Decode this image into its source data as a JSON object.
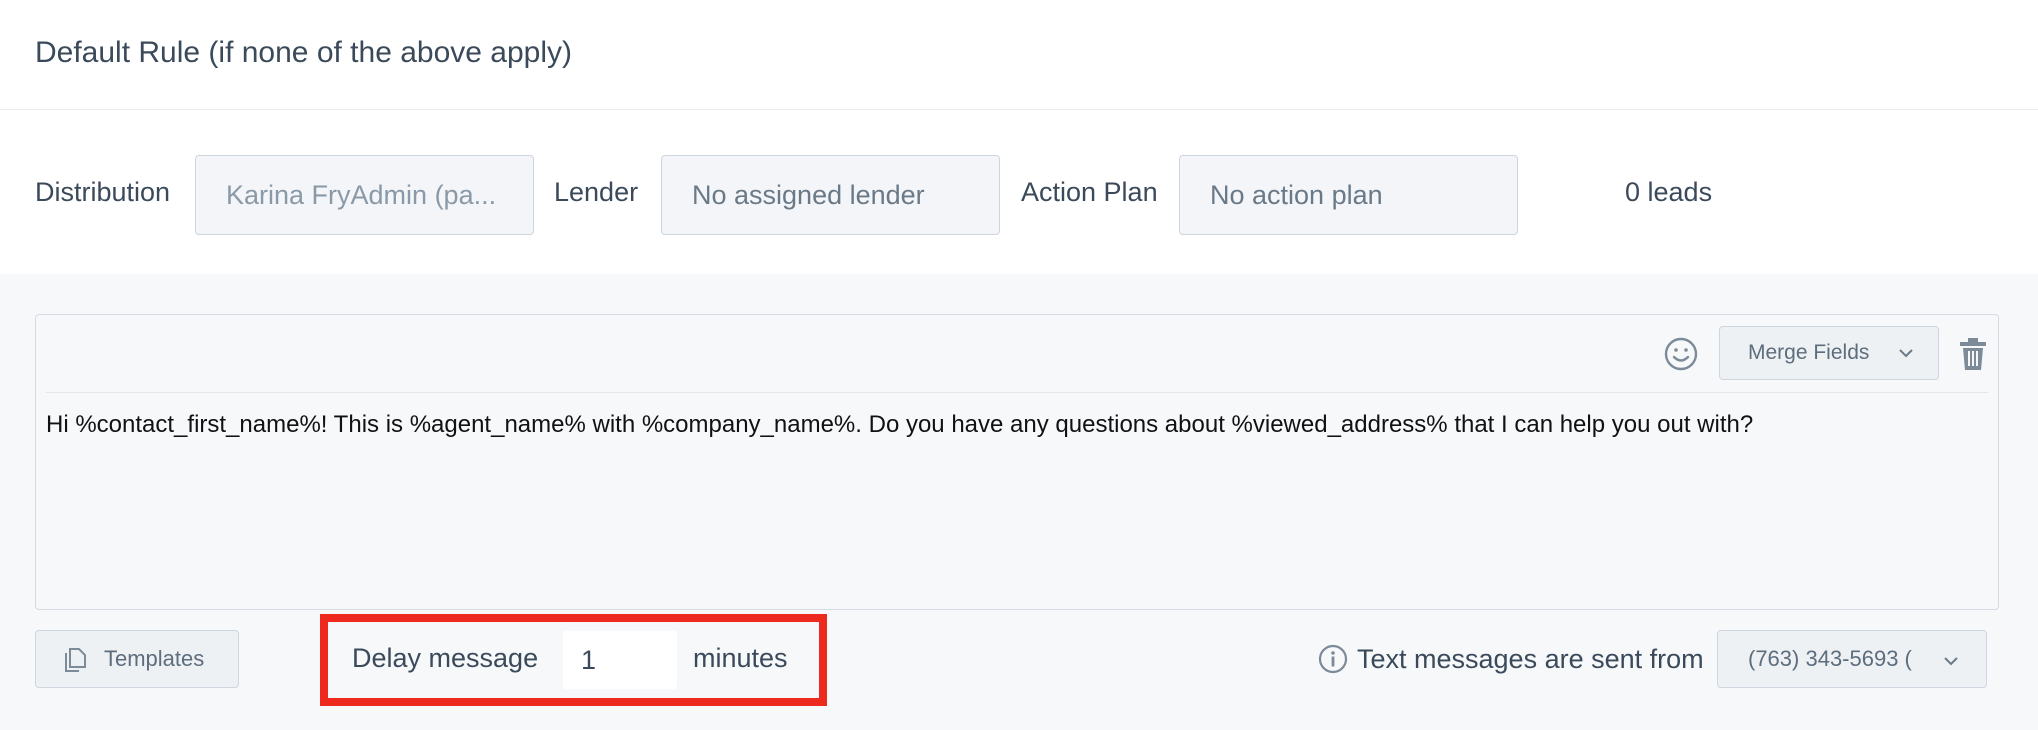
{
  "header": {
    "title": "Default Rule (if none of the above apply)"
  },
  "rule": {
    "distribution_label": "Distribution",
    "distribution_value": "Karina FryAdmin (pa...",
    "lender_label": "Lender",
    "lender_value": "No assigned lender",
    "action_plan_label": "Action Plan",
    "action_plan_value": "No action plan",
    "leads_count": "0 leads"
  },
  "editor": {
    "merge_fields_label": "Merge Fields",
    "message": "Hi %contact_first_name%! This is %agent_name% with %company_name%. Do you have any questions about %viewed_address% that I can help you out with?",
    "icons": {
      "emoji": "smiley-icon",
      "merge_chevron": "chevron-down-icon",
      "delete": "trash-icon"
    }
  },
  "footer": {
    "templates_label": "Templates",
    "delay_label": "Delay message",
    "delay_value": "1",
    "delay_unit": "minutes",
    "sent_from_label": "Text messages are sent from",
    "phone_value": "(763) 343-5693 (",
    "icons": {
      "templates": "copy-icon",
      "info": "info-icon",
      "phone_chevron": "chevron-down-icon"
    }
  },
  "colors": {
    "highlight": "#ee2a1f",
    "panel_bg": "#f6f8fa",
    "text": "#3b4a5a"
  }
}
